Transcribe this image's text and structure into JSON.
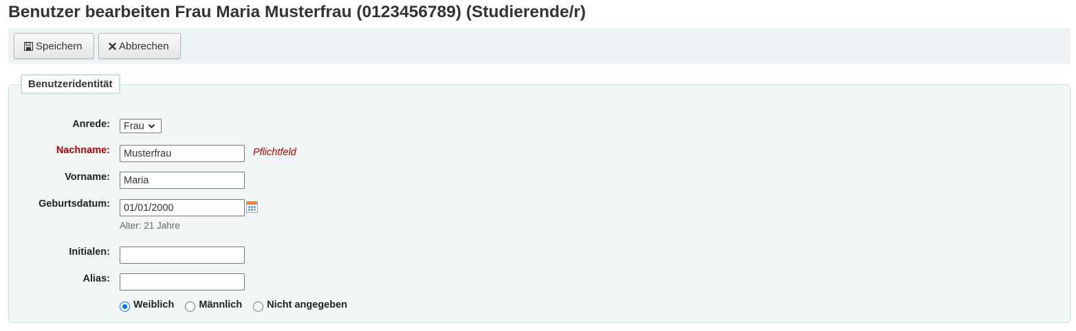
{
  "page": {
    "title": "Benutzer bearbeiten Frau Maria Musterfrau (0123456789) (Studierende/r)"
  },
  "toolbar": {
    "save_label": "Speichern",
    "save_icon": "floppy-disk-icon",
    "cancel_label": "Abbrechen",
    "cancel_icon": "close-icon"
  },
  "identity": {
    "legend": "Benutzeridentität",
    "salutation": {
      "label": "Anrede:",
      "value": "Frau"
    },
    "surname": {
      "label": "Nachname:",
      "value": "Musterfrau",
      "required_hint": "Pflichtfeld",
      "required_color": "#b00000"
    },
    "firstname": {
      "label": "Vorname:",
      "value": "Maria"
    },
    "dob": {
      "label": "Geburtsdatum:",
      "value": "01/01/2000",
      "age_hint": "Alter: 21 Jahre",
      "icon": "calendar-icon"
    },
    "initials": {
      "label": "Initialen:",
      "value": ""
    },
    "alias": {
      "label": "Alias:",
      "value": ""
    },
    "gender": {
      "options": [
        {
          "label": "Weiblich",
          "checked": true
        },
        {
          "label": "Männlich",
          "checked": false
        },
        {
          "label": "Nicht angegeben",
          "checked": false
        }
      ]
    }
  },
  "colors": {
    "toolbar_bg": "#edf3f4",
    "fieldset_bg": "#f3f6f7",
    "fieldset_border": "#c5e3dc",
    "radio_accent": "#0075ff"
  }
}
